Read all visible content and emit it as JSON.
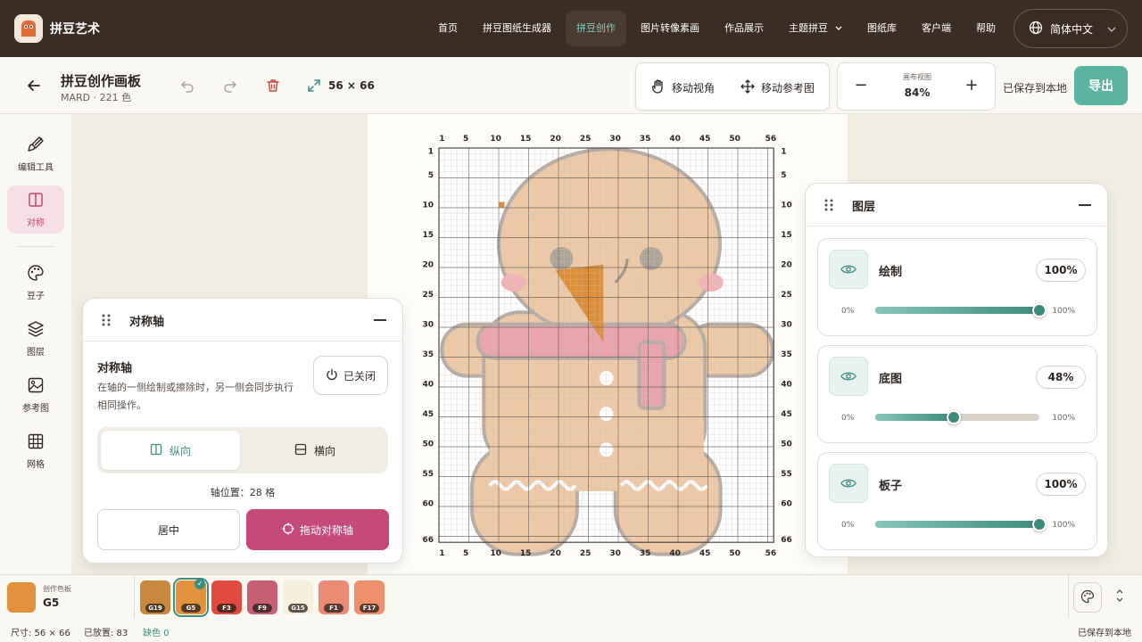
{
  "app": {
    "brand": "拼豆艺术"
  },
  "nav": {
    "items": [
      {
        "label": "首页",
        "active": false
      },
      {
        "label": "拼豆图纸生成器",
        "active": false
      },
      {
        "label": "拼豆创作",
        "active": true
      },
      {
        "label": "图片转像素画",
        "active": false
      },
      {
        "label": "作品展示",
        "active": false
      },
      {
        "label": "主题拼豆",
        "active": false,
        "has_dropdown": true
      },
      {
        "label": "图纸库",
        "active": false
      },
      {
        "label": "客户端",
        "active": false
      },
      {
        "label": "帮助",
        "active": false
      }
    ],
    "language": "简体中文"
  },
  "toolbar": {
    "title": "拼豆创作画板",
    "subtitle": "MARD · 221 色",
    "grid_size": "56 × 66",
    "move_view": "移动视角",
    "move_reference": "移动参考图",
    "zoom_label": "画布视图",
    "zoom_value": "84%",
    "zoom_out": "−",
    "zoom_in": "+",
    "saved": "已保存到本地",
    "export": "导出"
  },
  "rail": {
    "items": [
      {
        "label": "编辑工具",
        "icon": "brush-icon"
      },
      {
        "label": "对称",
        "icon": "symmetry-icon",
        "active": true
      },
      {
        "label": "豆子",
        "icon": "palette-icon"
      },
      {
        "label": "图层",
        "icon": "layers-icon"
      },
      {
        "label": "参考图",
        "icon": "image-icon"
      },
      {
        "label": "网格",
        "icon": "grid-icon"
      }
    ]
  },
  "symmetry": {
    "panel_title": "对称轴",
    "heading": "对称轴",
    "description": "在轴的一侧绘制或擦除时，另一侧会同步执行相同操作。",
    "toggle_label": "已关闭",
    "vertical": "纵向",
    "horizontal": "横向",
    "selected_orientation": "vertical",
    "axis_position": "轴位置：28 格",
    "center_button": "居中",
    "drag_button": "拖动对称轴"
  },
  "layers": {
    "panel_title": "图层",
    "items": [
      {
        "name": "绘制",
        "opacity_label": "100%",
        "opacity": 1.0,
        "min": "0%",
        "max": "100%"
      },
      {
        "name": "底图",
        "opacity_label": "48%",
        "opacity": 0.48,
        "min": "0%",
        "max": "100%"
      },
      {
        "name": "板子",
        "opacity_label": "100%",
        "opacity": 1.0,
        "min": "0%",
        "max": "100%"
      }
    ]
  },
  "canvas": {
    "columns": 56,
    "rows": 66,
    "top_ticks": [
      "1",
      "5",
      "10",
      "15",
      "20",
      "25",
      "30",
      "35",
      "40",
      "45",
      "50",
      "56"
    ],
    "side_ticks": [
      "1",
      "5",
      "10",
      "15",
      "20",
      "25",
      "30",
      "35",
      "40",
      "45",
      "50",
      "55",
      "60",
      "66"
    ]
  },
  "palette": {
    "current_label": "创作色板",
    "current_code": "G5",
    "current_color": "#e2913c",
    "swatches": [
      {
        "code": "G19",
        "color": "#c9883d"
      },
      {
        "code": "G5",
        "color": "#e2913c",
        "selected": true
      },
      {
        "code": "F3",
        "color": "#e34a3f"
      },
      {
        "code": "F9",
        "color": "#c85f72"
      },
      {
        "code": "G15",
        "color": "#f5f0dc"
      },
      {
        "code": "F1",
        "color": "#ec8a73"
      },
      {
        "code": "F17",
        "color": "#ef8e6a"
      }
    ]
  },
  "status": {
    "size": "尺寸: 56 × 66",
    "placed": "已放置: 83",
    "missing": "缺色 0",
    "saved": "已保存到本地"
  },
  "colors": {
    "accent": "#5db3a2",
    "nav_bg": "#3b2d24",
    "primary_pink": "#c64a78"
  }
}
